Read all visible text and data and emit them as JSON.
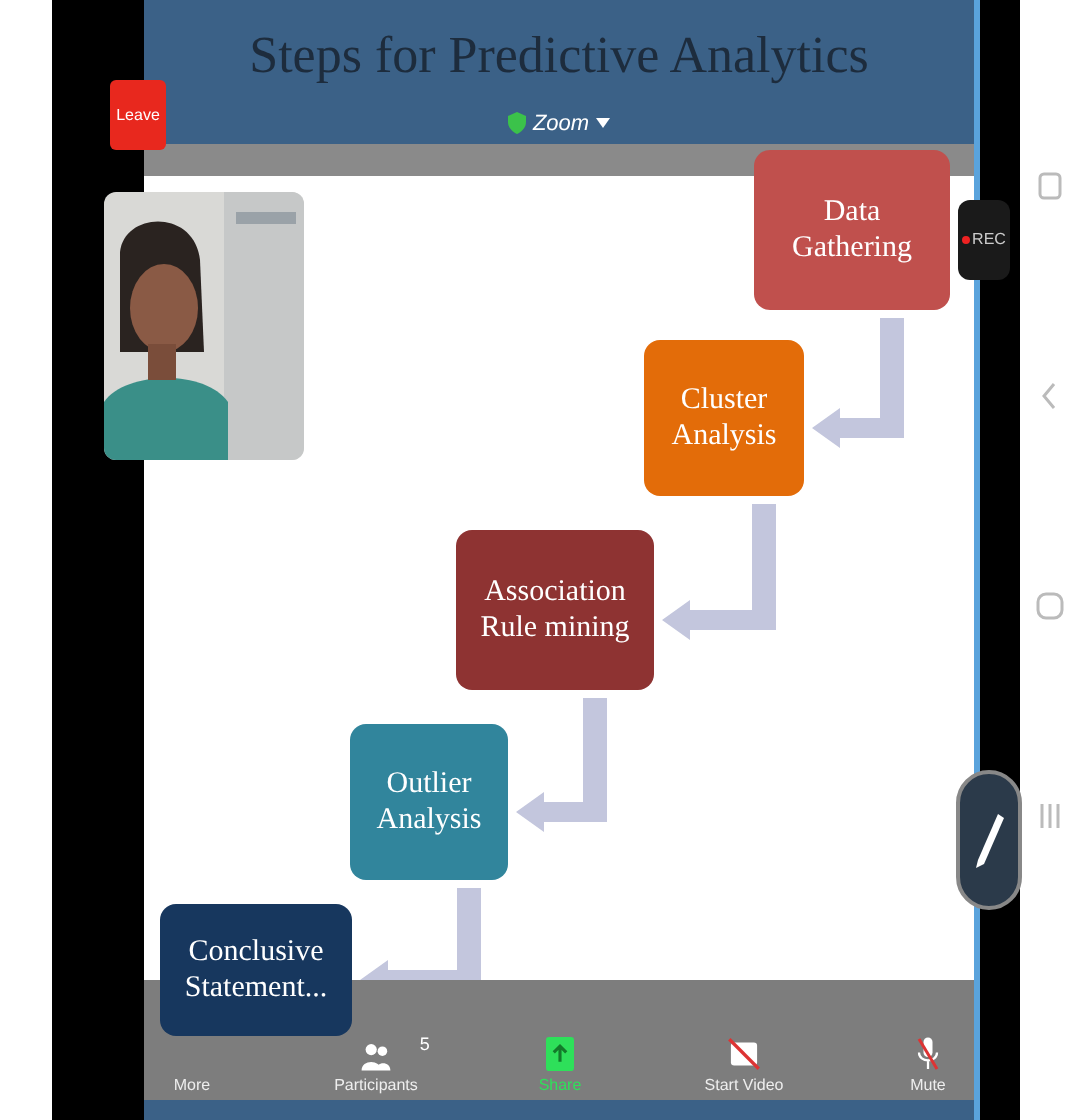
{
  "meeting": {
    "app_label": "Zoom",
    "leave": "Leave",
    "recording": "REC"
  },
  "slide": {
    "title": "Steps for Predictive Analytics",
    "steps": [
      {
        "label": "Data Gathering",
        "color": "#c0504d"
      },
      {
        "label": "Cluster Analysis",
        "color": "#e36c09"
      },
      {
        "label": "Association Rule mining",
        "color": "#8e3332"
      },
      {
        "label": "Outlier Analysis",
        "color": "#31859c"
      },
      {
        "label": "Conclusive Statement...",
        "color": "#17375e"
      }
    ]
  },
  "toolbar": [
    {
      "label": "More",
      "selected": false
    },
    {
      "label": "Participants",
      "count": "5",
      "selected": false
    },
    {
      "label": "Share",
      "selected": true
    },
    {
      "label": "Start Video",
      "selected": false
    },
    {
      "label": "Mute",
      "selected": false
    }
  ]
}
